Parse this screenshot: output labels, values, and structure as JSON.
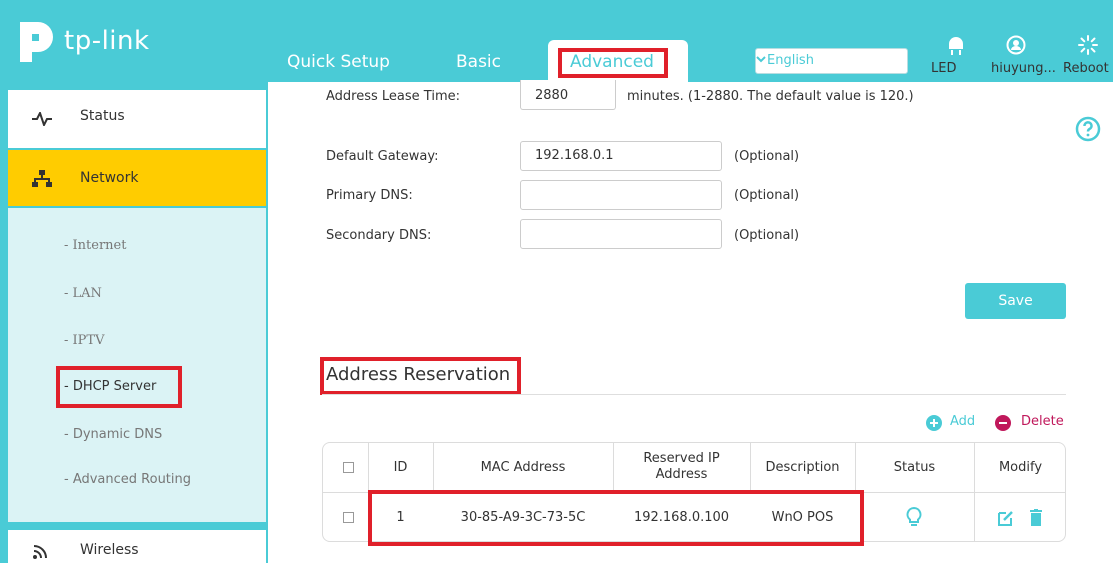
{
  "brand": {
    "name": "tp-link"
  },
  "nav": {
    "tabs": [
      {
        "label": "Quick Setup"
      },
      {
        "label": "Basic"
      },
      {
        "label": "Advanced"
      }
    ],
    "language": "English",
    "led_label": "LED",
    "user_label": "hiuyung...",
    "reboot_label": "Reboot"
  },
  "sidebar": {
    "status": "Status",
    "network": "Network",
    "sub_items": [
      "- Internet",
      "- LAN",
      "- IPTV",
      "- DHCP Server",
      "- Dynamic DNS",
      "- Advanced Routing"
    ],
    "wireless": "Wireless"
  },
  "form": {
    "lease_label": "Address Lease Time:",
    "lease_value": "2880",
    "lease_hint": "minutes. (1-2880. The default value is 120.)",
    "gateway_label": "Default Gateway:",
    "gateway_value": "192.168.0.1",
    "primary_dns_label": "Primary DNS:",
    "primary_dns_value": "",
    "secondary_dns_label": "Secondary DNS:",
    "secondary_dns_value": "",
    "optional": "(Optional)",
    "save_label": "Save"
  },
  "reservation": {
    "title": "Address Reservation",
    "add_label": "Add",
    "delete_label": "Delete",
    "columns": [
      "ID",
      "MAC Address",
      "Reserved IP Address",
      "Description",
      "Status",
      "Modify"
    ],
    "rows": [
      {
        "id": "1",
        "mac": "30-85-A9-3C-73-5C",
        "ip": "192.168.0.100",
        "description": "WnO POS"
      }
    ]
  },
  "colors": {
    "accent": "#4acbd6",
    "highlight": "#ffcc00",
    "annotation": "#e0202a",
    "delete": "#c0185b"
  }
}
